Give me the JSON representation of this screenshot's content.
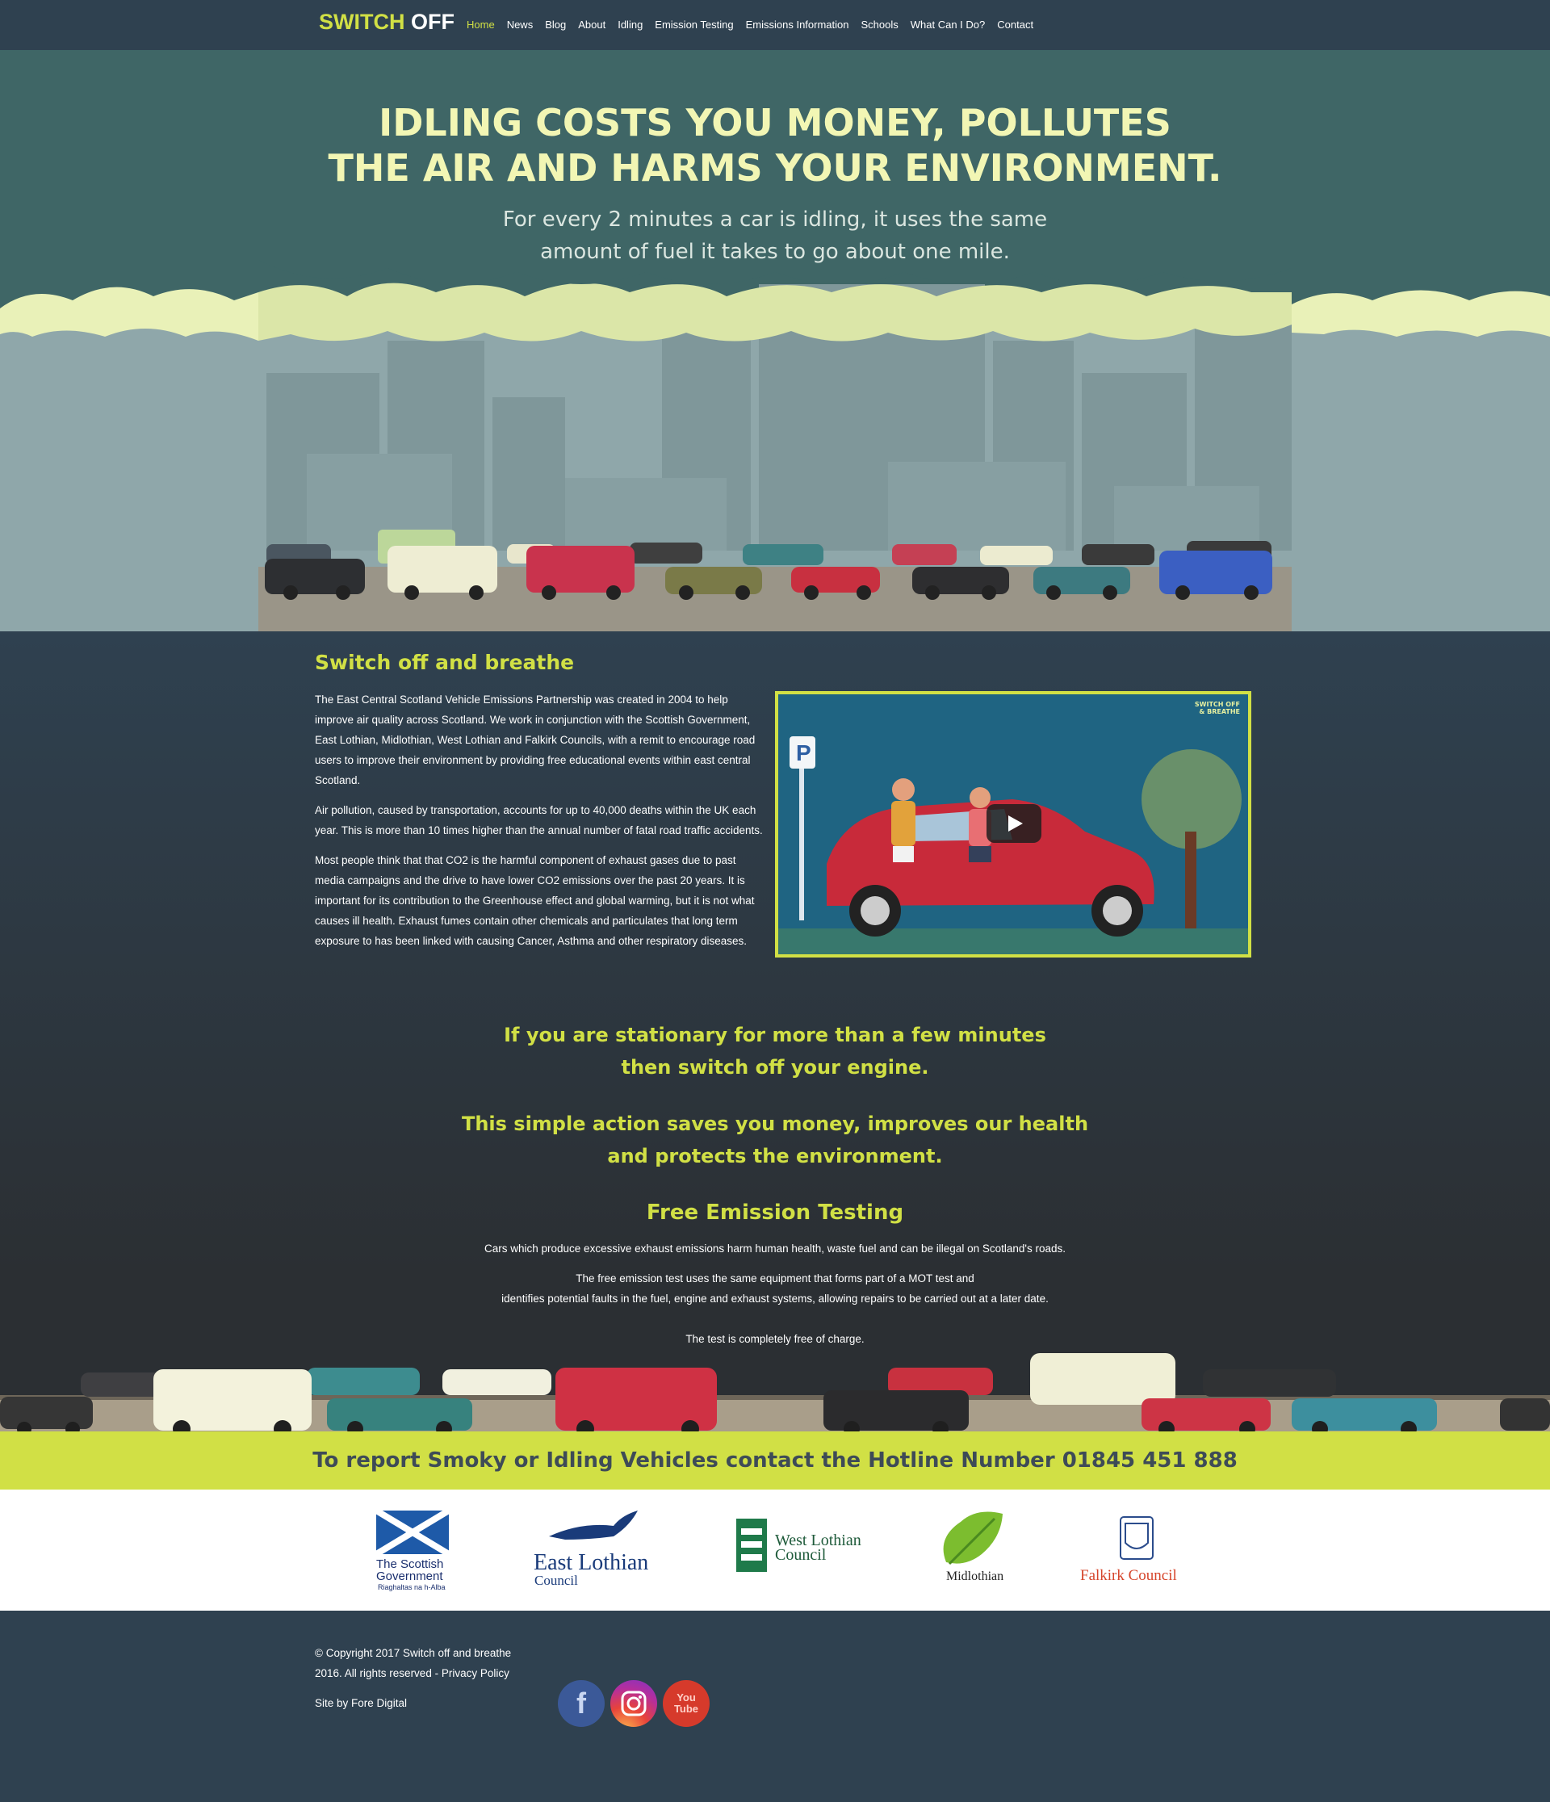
{
  "nav": {
    "logo_part1": "SWITCH",
    "logo_part2": "OFF",
    "items": [
      "Home",
      "News",
      "Blog",
      "About",
      "Idling",
      "Emission Testing",
      "Emissions Information",
      "Schools",
      "What Can I Do?",
      "Contact"
    ]
  },
  "hero": {
    "title_line1": "IDLING COSTS YOU MONEY, POLLUTES",
    "title_line2": "THE AIR AND HARMS YOUR ENVIRONMENT.",
    "sub_line1": "For every 2 minutes a car is idling, it uses the same",
    "sub_line2": "amount of fuel it takes to go about one mile."
  },
  "intro": {
    "heading": "Switch off and breathe",
    "p1": "The East Central Scotland Vehicle Emissions Partnership was created in 2004 to help improve air quality across Scotland. We work in conjunction with the Scottish Government, East Lothian, Midlothian, West Lothian and Falkirk Councils, with a remit to encourage road users to improve their environment by providing free educational events within east central Scotland.",
    "p2": "Air pollution, caused by transportation, accounts for up to 40,000 deaths within the UK each year. This is more than 10 times higher than the annual number of fatal road traffic accidents.",
    "p3": "Most people think that that CO2 is the harmful component of exhaust gases due to past media campaigns and the drive to have lower CO2 emissions over the past 20 years. It is important for its contribution to the Greenhouse effect and global warming, but it is not what causes ill health. Exhaust fumes contain other chemicals and particulates that long term exposure to has been linked with causing Cancer, Asthma and other respiratory diseases.",
    "video_badge_line1": "SWITCH OFF",
    "video_badge_line2": "& BREATHE",
    "video_sign": "P"
  },
  "callouts": {
    "c1_line1": "If you are stationary for more than a few minutes",
    "c1_line2": "then switch off your engine.",
    "c2_line1": "This simple action saves you money, improves our health",
    "c2_line2": "and protects the environment."
  },
  "testing": {
    "heading": "Free Emission Testing",
    "p1": "Cars which produce excessive exhaust emissions harm human health, waste fuel and can be illegal on Scotland's roads.",
    "p2_line1": "The free emission test uses the same equipment that forms part of a MOT test and",
    "p2_line2": "identifies potential faults in the fuel, engine and exhaust systems, allowing repairs to be carried out at a later date.",
    "p3": "The test is completely free of charge."
  },
  "hotline": {
    "text": "To report Smoky or Idling Vehicles contact the Hotline Number 01845 451 888"
  },
  "partners": {
    "scottish_gov_line1": "The Scottish",
    "scottish_gov_line2": "Government",
    "scottish_gov_line3": "Riaghaltas na h-Alba",
    "east_lothian_line1": "East Lothian",
    "east_lothian_line2": "Council",
    "west_lothian_line1": "West Lothian",
    "west_lothian_line2": "Council",
    "midlothian": "Midlothian",
    "falkirk": "Falkirk Council"
  },
  "footer": {
    "copyright_line1": "© Copyright 2017 Switch off and breathe",
    "copyright_line2": "2016. All rights reserved - Privacy Policy",
    "site_by": "Site by Fore Digital",
    "facebook_glyph": "f",
    "youtube_line1": "You",
    "youtube_line2": "Tube"
  },
  "colors": {
    "accent": "#d1e045",
    "navy": "#2f4150",
    "hero_title": "#f2f6b4"
  }
}
